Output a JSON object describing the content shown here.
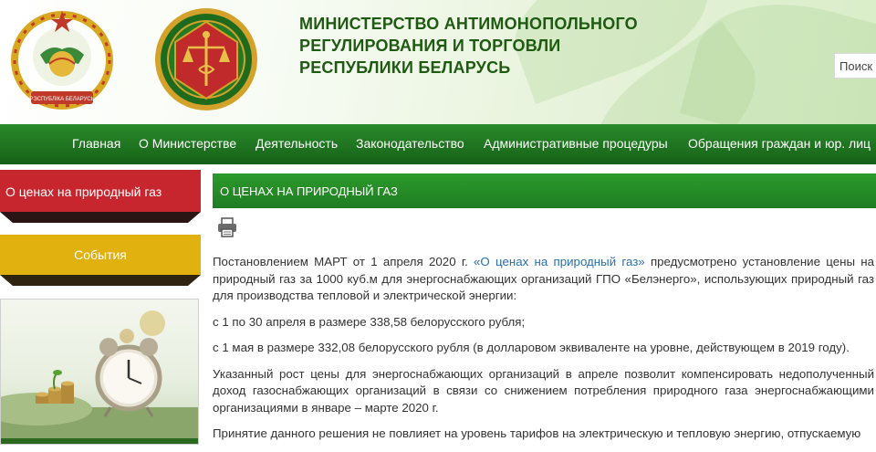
{
  "header": {
    "title_lines": [
      "МИНИСТЕРСТВО АНТИМОНОПОЛЬНОГО",
      "РЕГУЛИРОВАНИЯ И ТОРГОВЛИ",
      "РЕСПУБЛИКИ БЕЛАРУСЬ"
    ],
    "emblem_text": "РЭСПУБЛІКА БЕЛАРУСЬ",
    "seal_text": "МИНИСТЕРСТВО АНТИМОНОПОЛЬНОГО РЕГУЛИРОВАНИЯ И ТОРГОВЛИ",
    "search_placeholder": "Поиск"
  },
  "nav": {
    "items": [
      "Главная",
      "О Министерстве",
      "Деятельность",
      "Законодательство",
      "Административные процедуры",
      "Обращения граждан и юр. лиц"
    ]
  },
  "sidebar": {
    "red_label": "О ценах на природный газ",
    "yellow_label": "События"
  },
  "content": {
    "title": "О ЦЕНАХ НА ПРИРОДНЫЙ ГАЗ",
    "p1_before": "Постановлением МАРТ от 1 апреля 2020 г. ",
    "p1_link": "«О ценах на природный газ»",
    "p1_after": " предусмотрено установление цены на природный газ за 1000 куб.м для энергоснабжающих организаций ГПО «Белэнерго», использующих природный газ для производства тепловой и электрической энергии:",
    "p2": "с 1 по 30 апреля в размере 338,58 белорусского рубля;",
    "p3": "с 1 мая в размере 332,08 белорусского рубля (в долларовом эквиваленте на уровне, действующем в 2019 году).",
    "p4": "Указанный рост цены для энергоснабжающих организаций в апреле позволит компенсировать недополученный доход газоснабжающих организаций в связи со снижением потребления природного газа энергоснабжающими организациями в январе – марте 2020 г.",
    "p5": "Принятие данного решения не повлияет на уровень тарифов на электрическую и тепловую энергию, отпускаемую"
  },
  "colors": {
    "brand_green": "#1f7420",
    "title_green": "#1e5a12",
    "side_red": "#c8262e",
    "side_yellow": "#e0b10f",
    "link_blue": "#2a6fb0"
  },
  "icons": [
    "state-emblem-icon",
    "ministry-seal-icon",
    "print-icon",
    "clock-icon"
  ]
}
